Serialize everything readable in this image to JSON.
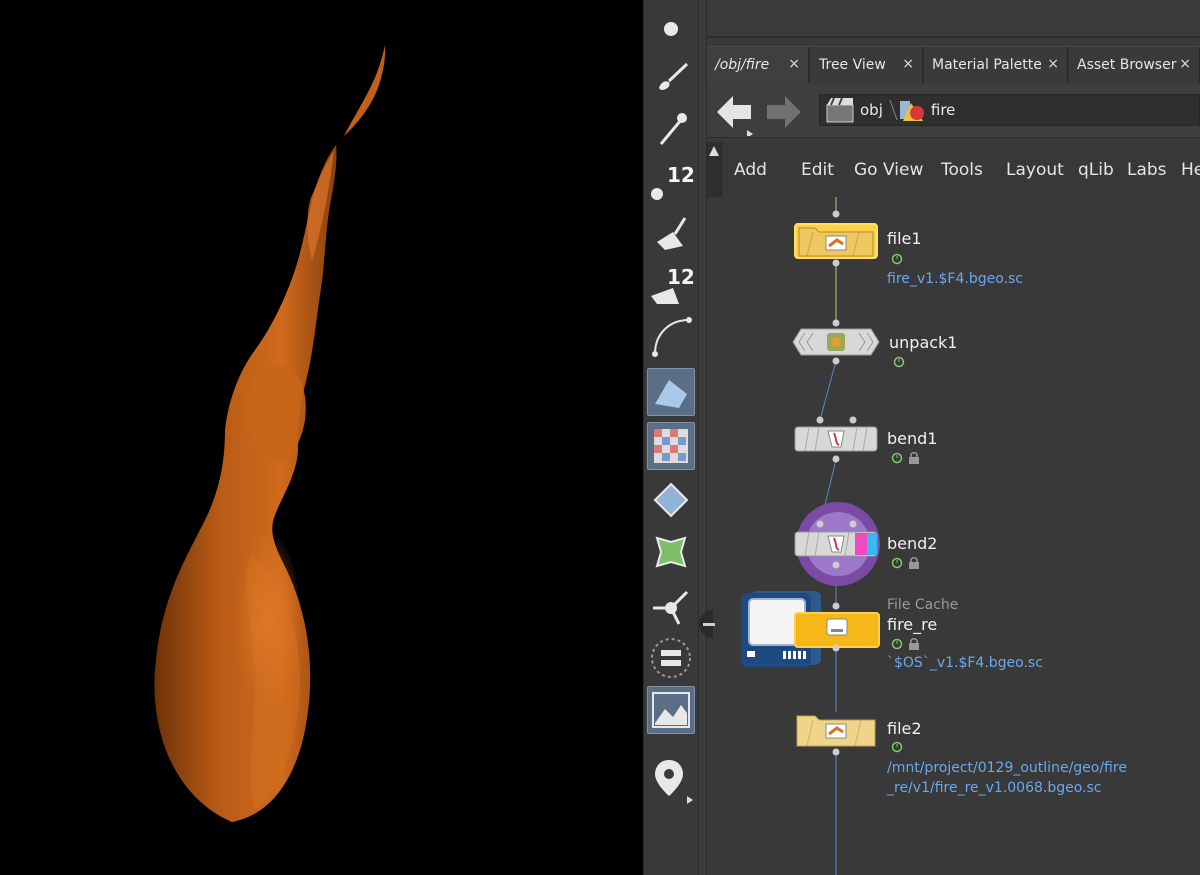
{
  "tabs": [
    {
      "label": "/obj/fire",
      "close": "×"
    },
    {
      "label": "Tree View",
      "close": "×"
    },
    {
      "label": "Material Palette",
      "close": "×"
    },
    {
      "label": "Asset Browser",
      "close": "×"
    }
  ],
  "path": {
    "items": [
      "obj",
      "fire"
    ]
  },
  "menu": [
    "Add",
    "Edit",
    "Go",
    "View",
    "Tools",
    "Layout",
    "qLib",
    "Labs",
    "He"
  ],
  "shelf": {
    "badges": [
      "12",
      "12"
    ]
  },
  "nodes": {
    "file1": {
      "name": "file1",
      "path": "fire_v1.$F4.bgeo.sc"
    },
    "unpack1": {
      "name": "unpack1"
    },
    "bend1": {
      "name": "bend1"
    },
    "bend2": {
      "name": "bend2"
    },
    "fire_re": {
      "type": "File Cache",
      "name": "fire_re",
      "path": "`$OS`_v1.$F4.bgeo.sc"
    },
    "file2": {
      "name": "file2",
      "path_line1": "/mnt/project/0129_outline/geo/fire",
      "path_line2": "_re/v1/fire_re_v1.0068.bgeo.sc"
    }
  },
  "colors": {
    "flame": "#c0601a",
    "link": "#6aa8ee",
    "node_yellow": "#f3c23a",
    "selected_ring": "#8a4fb0"
  }
}
